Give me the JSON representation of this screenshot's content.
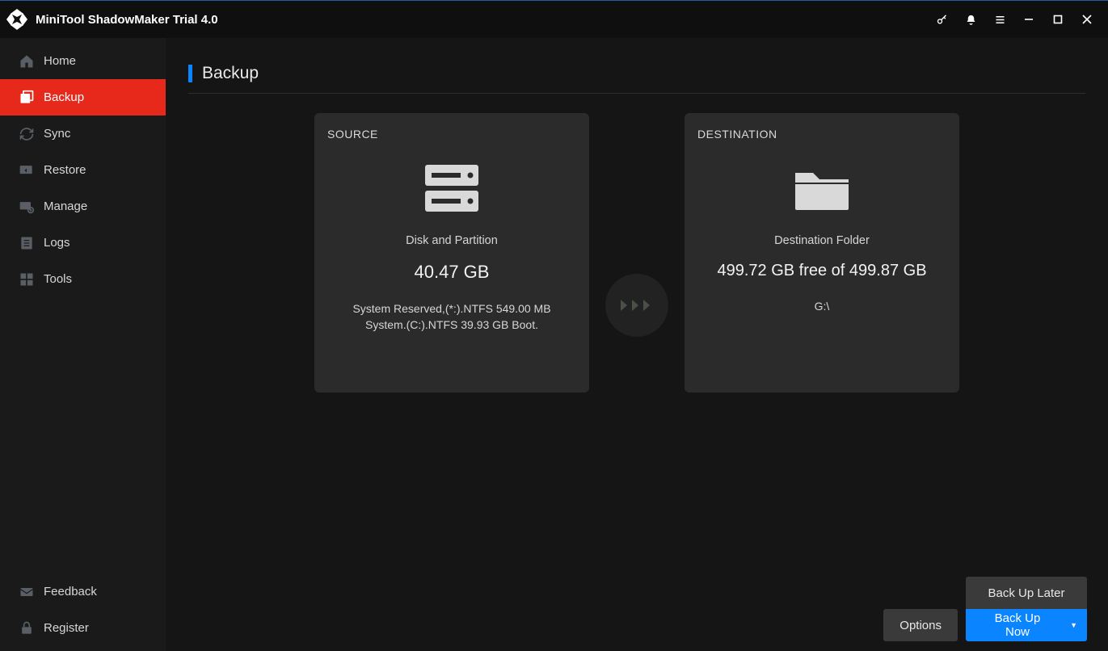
{
  "app": {
    "title": "MiniTool ShadowMaker Trial 4.0"
  },
  "sidebar": {
    "items": [
      {
        "label": "Home",
        "icon": "home-icon"
      },
      {
        "label": "Backup",
        "icon": "backup-icon"
      },
      {
        "label": "Sync",
        "icon": "sync-icon"
      },
      {
        "label": "Restore",
        "icon": "restore-icon"
      },
      {
        "label": "Manage",
        "icon": "manage-icon"
      },
      {
        "label": "Logs",
        "icon": "logs-icon"
      },
      {
        "label": "Tools",
        "icon": "tools-icon"
      }
    ],
    "bottom": [
      {
        "label": "Feedback",
        "icon": "feedback-icon"
      },
      {
        "label": "Register",
        "icon": "register-icon"
      }
    ],
    "active_index": 1
  },
  "page": {
    "title": "Backup"
  },
  "source": {
    "heading": "SOURCE",
    "type_label": "Disk and Partition",
    "size": "40.47 GB",
    "details": "System Reserved,(*:).NTFS 549.00 MB System.(C:).NTFS 39.93 GB Boot."
  },
  "destination": {
    "heading": "DESTINATION",
    "type_label": "Destination Folder",
    "free_text": "499.72 GB free of 499.87 GB",
    "path": "G:\\"
  },
  "actions": {
    "options": "Options",
    "backup_later": "Back Up Later",
    "backup_now": "Back Up Now"
  }
}
